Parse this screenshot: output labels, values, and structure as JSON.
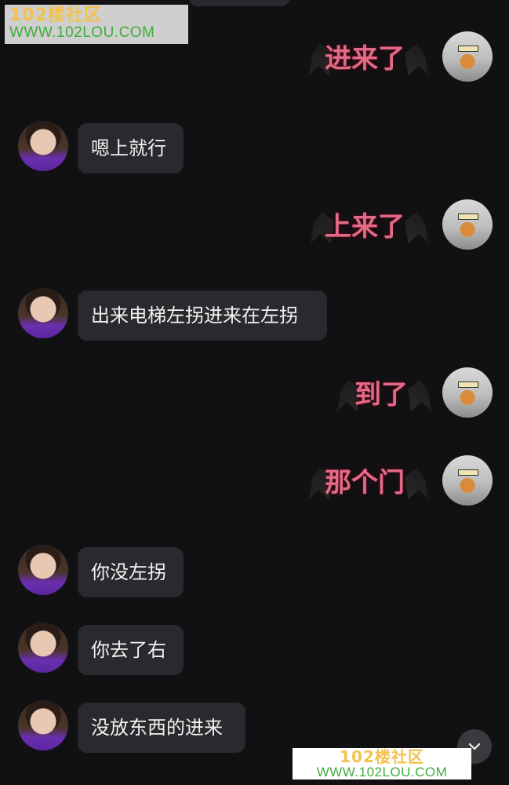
{
  "watermark": {
    "top_cn": "102楼社区",
    "top_url": "WWW.102LOU.COM",
    "bottom_cn": "102楼社区",
    "bottom_url": "WWW.102LOU.COM"
  },
  "messages": [
    {
      "side": "right",
      "type": "sticker",
      "text": "进来了"
    },
    {
      "side": "left",
      "type": "bubble",
      "text": "嗯上就行"
    },
    {
      "side": "right",
      "type": "sticker",
      "text": "上来了"
    },
    {
      "side": "left",
      "type": "bubble",
      "text": "出来电梯左拐进来在左拐"
    },
    {
      "side": "right",
      "type": "sticker",
      "text": "到了"
    },
    {
      "side": "right",
      "type": "sticker",
      "text": "那个门"
    },
    {
      "side": "left",
      "type": "bubble",
      "text": "你没左拐"
    },
    {
      "side": "left",
      "type": "bubble",
      "text": "你去了右"
    },
    {
      "side": "left",
      "type": "bubble",
      "text": "没放东西的进来"
    }
  ],
  "icons": {
    "scroll_down": "chevron-down-icon"
  },
  "colors": {
    "background": "#111114",
    "bubble": "#2a2a2e",
    "sticker_text": "#e36a86"
  }
}
